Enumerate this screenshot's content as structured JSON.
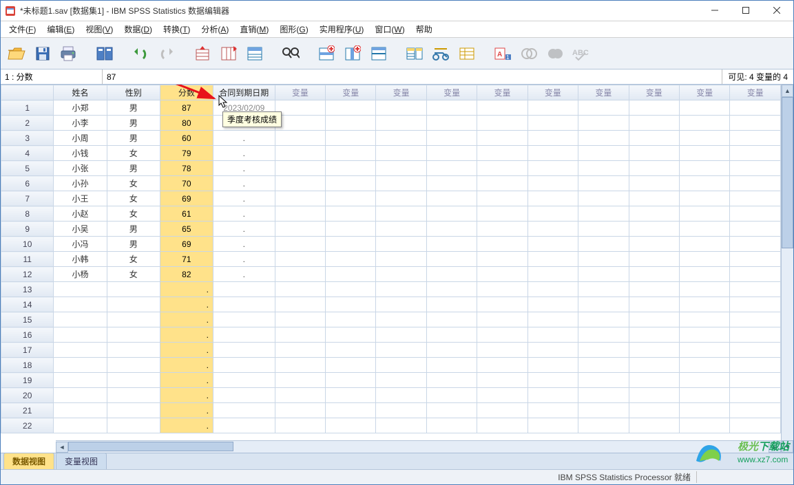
{
  "title": "*未标题1.sav [数据集1] - IBM SPSS Statistics 数据编辑器",
  "menu": [
    "文件(F)",
    "编辑(E)",
    "视图(V)",
    "数据(D)",
    "转换(T)",
    "分析(A)",
    "直销(M)",
    "图形(G)",
    "实用程序(U)",
    "窗口(W)",
    "帮助"
  ],
  "ref": {
    "cell": "1 : 分数",
    "value": "87",
    "visible": "可见:   4 变量的 4"
  },
  "columns": {
    "vars": [
      "姓名",
      "性别",
      "分数",
      "合同到期日期"
    ],
    "selected_index": 2,
    "empty_label": "变量",
    "empty_count": 10
  },
  "data_rows": [
    {
      "姓名": "小郑",
      "性别": "男",
      "分数": "87",
      "合同到期日期": "2023/02/09"
    },
    {
      "姓名": "小李",
      "性别": "男",
      "分数": "80",
      "合同到期日期": "."
    },
    {
      "姓名": "小周",
      "性别": "男",
      "分数": "60",
      "合同到期日期": "."
    },
    {
      "姓名": "小钱",
      "性别": "女",
      "分数": "79",
      "合同到期日期": "."
    },
    {
      "姓名": "小张",
      "性别": "男",
      "分数": "78",
      "合同到期日期": "."
    },
    {
      "姓名": "小孙",
      "性别": "女",
      "分数": "70",
      "合同到期日期": "."
    },
    {
      "姓名": "小王",
      "性别": "女",
      "分数": "69",
      "合同到期日期": "."
    },
    {
      "姓名": "小赵",
      "性别": "女",
      "分数": "61",
      "合同到期日期": "."
    },
    {
      "姓名": "小吴",
      "性别": "男",
      "分数": "65",
      "合同到期日期": "."
    },
    {
      "姓名": "小冯",
      "性别": "男",
      "分数": "69",
      "合同到期日期": "."
    },
    {
      "姓名": "小韩",
      "性别": "女",
      "分数": "71",
      "合同到期日期": "."
    },
    {
      "姓名": "小杨",
      "性别": "女",
      "分数": "82",
      "合同到期日期": "."
    }
  ],
  "total_display_rows": 22,
  "tooltip": "季度考核成绩",
  "tabs": {
    "active": "数据视图",
    "inactive": "变量视图"
  },
  "status": "IBM SPSS Statistics Processor 就绪",
  "watermark": {
    "brand": "极光",
    "suffix": "下载站",
    "url": "www.xz7.com"
  },
  "icons": {
    "open": "open-icon",
    "save": "save-icon",
    "print": "print-icon",
    "recall": "recall-dialog-icon",
    "undo": "undo-icon",
    "redo": "redo-icon",
    "goto": "goto-case-icon",
    "gotovar": "goto-variable-icon",
    "variables": "variables-icon",
    "find": "find-icon",
    "insert-case": "insert-case-icon",
    "insert-var": "insert-variable-icon",
    "split": "split-file-icon",
    "weight": "weight-cases-icon",
    "select": "select-cases-icon",
    "value-labels": "value-labels-icon",
    "use-sets": "use-variable-sets-icon",
    "show-all": "show-all-icon",
    "spell": "spellcheck-icon",
    "run": "run-icon"
  }
}
